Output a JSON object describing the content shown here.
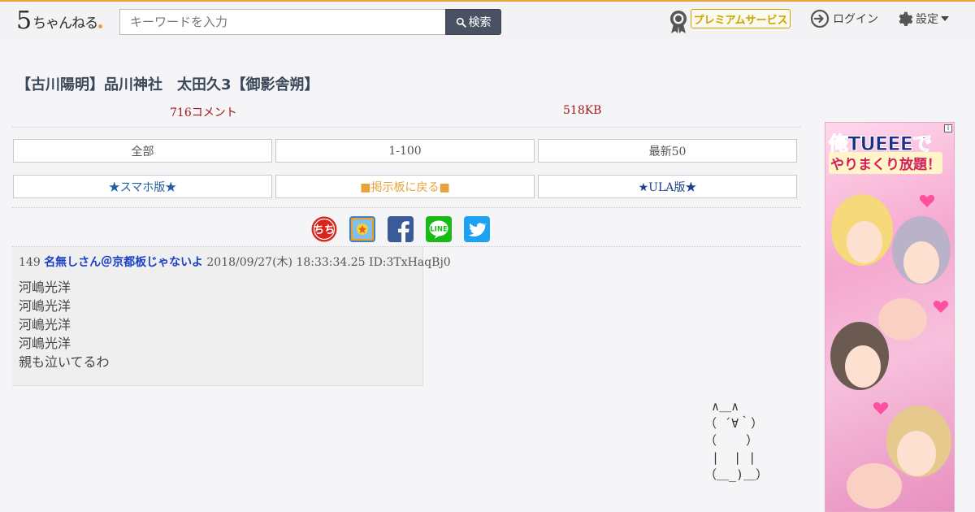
{
  "header": {
    "logo_text": "5ちゃんねる",
    "search_placeholder": "キーワードを入力",
    "search_button": "検索",
    "premium_label": "プレミアムサービス",
    "login_label": "ログイン",
    "settings_label": "設定"
  },
  "thread": {
    "title": "【古川陽明】品川神社　太田久3【御影舎朔】",
    "comments": "716コメント",
    "size": "518KB"
  },
  "nav": {
    "all": "全部",
    "range": "1-100",
    "latest": "最新50",
    "smartphone": "★スマホ版★",
    "back_to_board": "■掲示板に戻る■",
    "ula": "★ULA版★"
  },
  "share": {
    "five_ch_label": "ちちち"
  },
  "post": {
    "number": "149",
    "name": "名無しさん＠京都板じゃないよ",
    "date": "2018/09/27(木) 18:33:34.25",
    "id": "ID:3TxHaqBj0",
    "lines": [
      "河嶋光洋",
      "河嶋光洋",
      "河嶋光洋",
      "河嶋光洋",
      "親も泣いてるわ"
    ]
  },
  "ascii_art": "  ∧＿∧\n （ ´∀｀）\n （    ）\n  |  | |\n （＿_)＿）",
  "ad": {
    "headline_1": "俺TUEEEで",
    "headline_2": "やりまくり放題！"
  },
  "colors": {
    "accent": "#e9a23a",
    "title": "#3a4758",
    "meta_red": "#a3171c",
    "link_blue": "#1a3fc8",
    "back_orange": "#e9a23a",
    "premium_gold": "#c9a400"
  }
}
